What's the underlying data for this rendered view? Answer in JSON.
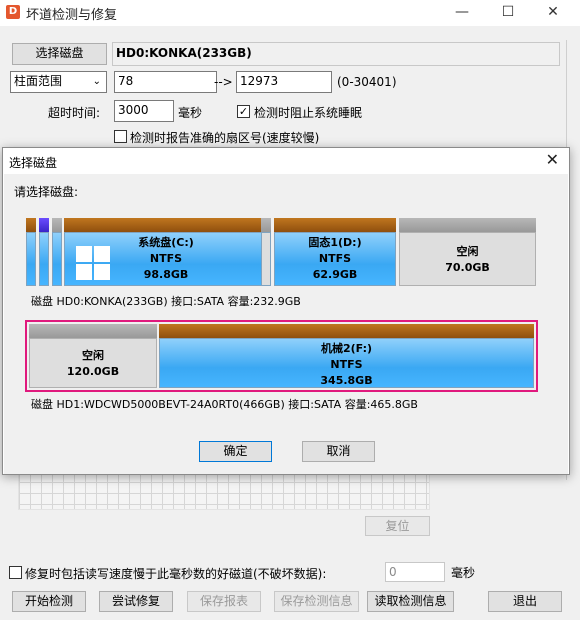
{
  "main": {
    "title": "坏道检测与修复",
    "icon_letter": "D",
    "minimize_icon": "—",
    "maximize_icon": "☐",
    "close_icon": "✕",
    "select_disk_button": "选择磁盘",
    "disk_name": "HD0:KONKA(233GB)",
    "range_select": "柱面范围",
    "range_start": "78",
    "range_arrow": "-->",
    "range_end": "12973",
    "range_hint": "(0-30401)",
    "timeout_label": "超时时间:",
    "timeout_value": "3000",
    "timeout_unit": "毫秒",
    "prevent_sleep_label": "检测时阻止系统睡眠",
    "prevent_sleep_checked": "✓",
    "report_sector_label": "检测时报告准确的扇区号(速度较慢)",
    "reset_button": "复位",
    "repair_slow_label": "修复时包括读写速度慢于此毫秒数的好磁道(不破坏数据):",
    "repair_slow_value": "0",
    "repair_slow_unit": "毫秒",
    "buttons": {
      "start": "开始检测",
      "try_repair": "尝试修复",
      "save_report": "保存报表",
      "save_info": "保存检测信息",
      "read_info": "读取检测信息",
      "exit": "退出"
    }
  },
  "dialog": {
    "title": "选择磁盘",
    "close_icon": "✕",
    "prompt": "请选择磁盘:",
    "disk0": {
      "partitions": [
        {
          "name": "系统盘(C:)",
          "fs": "NTFS",
          "size": "98.8GB"
        },
        {
          "name": "固态1(D:)",
          "fs": "NTFS",
          "size": "62.9GB"
        },
        {
          "name": "空闲",
          "size": "70.0GB"
        }
      ],
      "info": "磁盘 HD0:KONKA(233GB)  接口:SATA  容量:232.9GB"
    },
    "disk1": {
      "partitions": [
        {
          "name": "空闲",
          "size": "120.0GB"
        },
        {
          "name": "机械2(F:)",
          "fs": "NTFS",
          "size": "345.8GB"
        }
      ],
      "info": "磁盘 HD1:WDCWD5000BEVT-24A0RT0(466GB)  接口:SATA  容量:465.8GB"
    },
    "ok_button": "确定",
    "cancel_button": "取消"
  }
}
